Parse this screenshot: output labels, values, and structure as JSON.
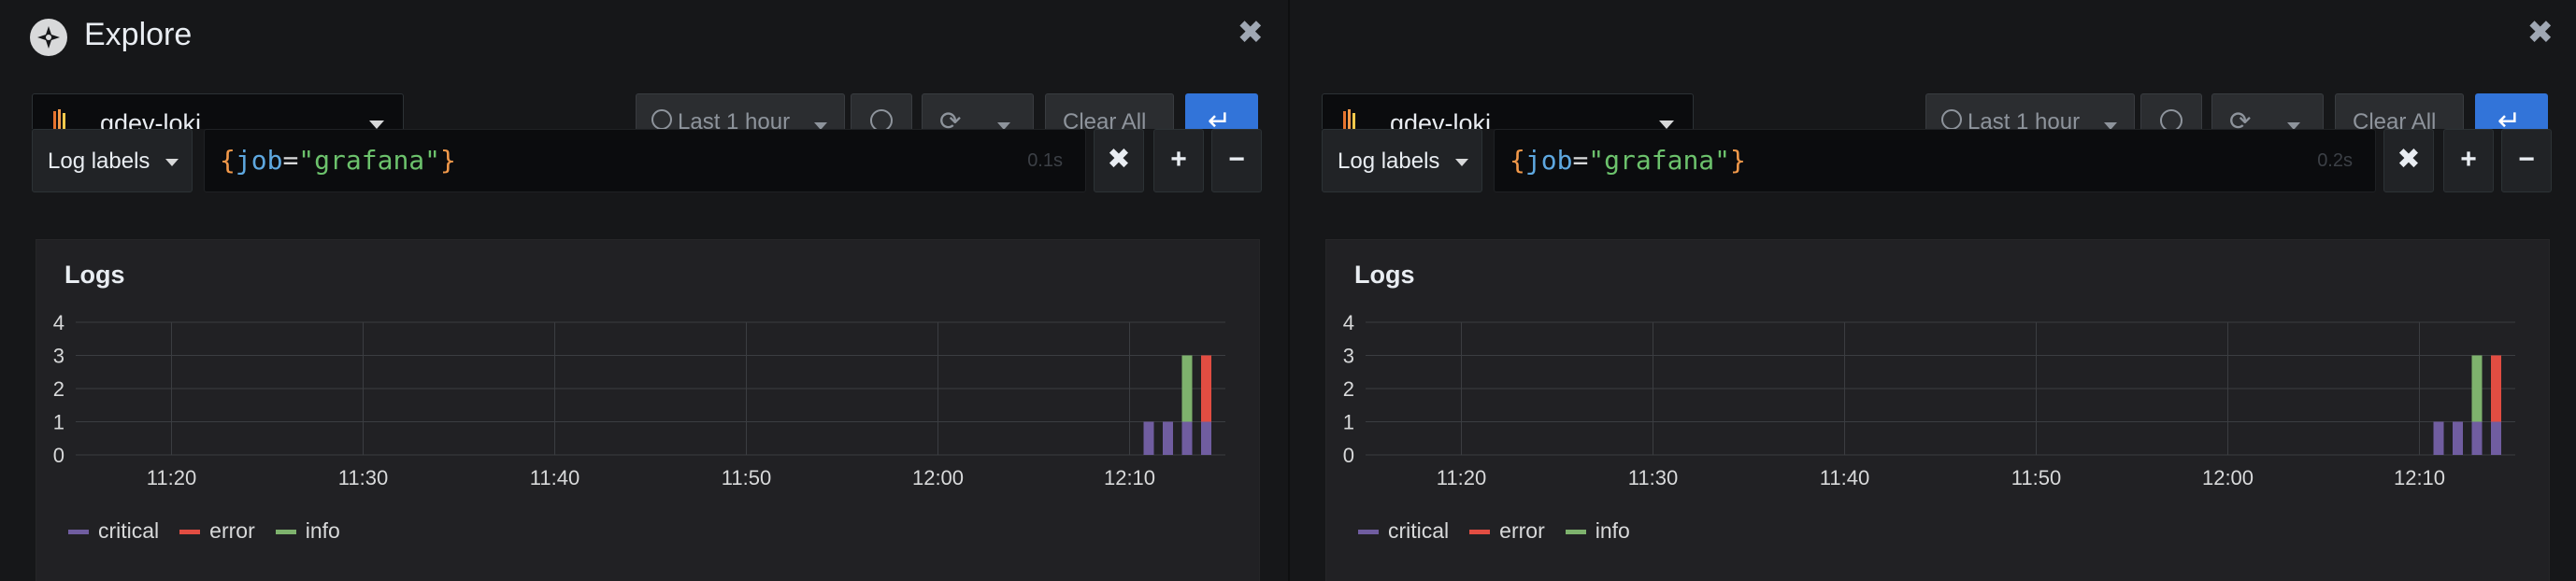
{
  "app": {
    "title": "Explore"
  },
  "panes": [
    {
      "datasource": {
        "name": "gdev-loki"
      },
      "toolbar": {
        "time_range": "Last 1 hour",
        "clear_all": "Clear All"
      },
      "query": {
        "log_labels": "Log labels",
        "expression": {
          "open": "{",
          "key": "job",
          "eq": "=",
          "value": "\"grafana\"",
          "close": "}"
        },
        "elapsed": "0.1s"
      },
      "logs": {
        "title": "Logs"
      }
    },
    {
      "datasource": {
        "name": "gdev-loki"
      },
      "toolbar": {
        "time_range": "Last 1 hour",
        "clear_all": "Clear All"
      },
      "query": {
        "log_labels": "Log labels",
        "expression": {
          "open": "{",
          "key": "job",
          "eq": "=",
          "value": "\"grafana\"",
          "close": "}"
        },
        "elapsed": "0.2s"
      },
      "logs": {
        "title": "Logs"
      }
    }
  ],
  "colors": {
    "critical": "#705da0",
    "error": "#e24d42",
    "info": "#7eb26d",
    "accent": "#3274d9"
  },
  "chart_data": [
    {
      "type": "bar",
      "stacked": true,
      "x_ticks": [
        "11:20",
        "11:30",
        "11:40",
        "11:50",
        "12:00",
        "12:10"
      ],
      "y_ticks": [
        "0",
        "1",
        "2",
        "3",
        "4"
      ],
      "ylim": [
        0,
        4
      ],
      "grid": true,
      "legend_position": "bottom-left",
      "x": [
        "12:11",
        "12:12",
        "12:13",
        "12:14"
      ],
      "series": [
        {
          "name": "critical",
          "color": "#705da0",
          "values": [
            1,
            1,
            1,
            1
          ]
        },
        {
          "name": "error",
          "color": "#e24d42",
          "values": [
            0,
            0,
            0,
            2
          ]
        },
        {
          "name": "info",
          "color": "#7eb26d",
          "values": [
            0,
            0,
            2,
            0
          ]
        }
      ]
    },
    {
      "type": "bar",
      "stacked": true,
      "x_ticks": [
        "11:20",
        "11:30",
        "11:40",
        "11:50",
        "12:00",
        "12:10"
      ],
      "y_ticks": [
        "0",
        "1",
        "2",
        "3",
        "4"
      ],
      "ylim": [
        0,
        4
      ],
      "grid": true,
      "legend_position": "bottom-left",
      "x": [
        "12:11",
        "12:12",
        "12:13",
        "12:14"
      ],
      "series": [
        {
          "name": "critical",
          "color": "#705da0",
          "values": [
            1,
            1,
            1,
            1
          ]
        },
        {
          "name": "error",
          "color": "#e24d42",
          "values": [
            0,
            0,
            0,
            2
          ]
        },
        {
          "name": "info",
          "color": "#7eb26d",
          "values": [
            0,
            0,
            2,
            0
          ]
        }
      ]
    }
  ]
}
